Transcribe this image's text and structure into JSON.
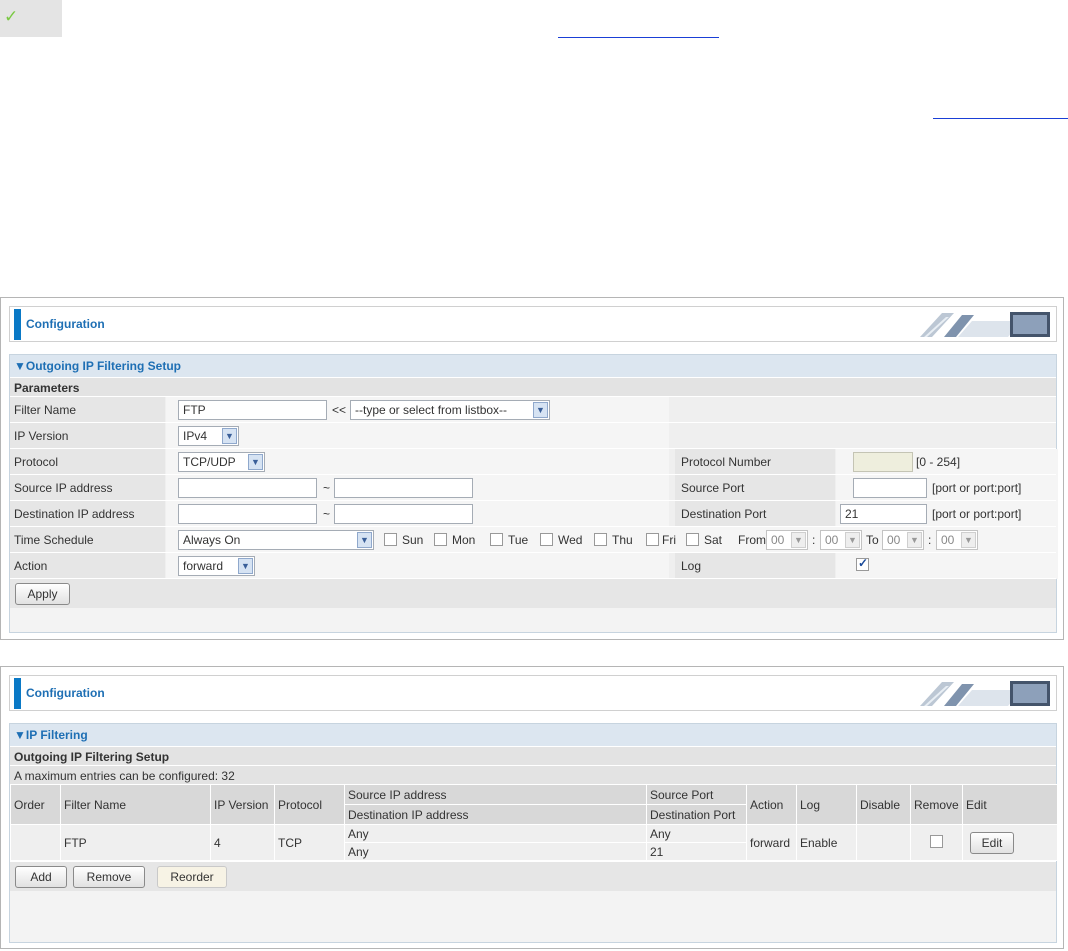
{
  "panel1": {
    "header": "Configuration",
    "section_title": "▼Outgoing IP Filtering Setup",
    "sub_header": "Parameters",
    "filter_name": {
      "label": "Filter Name",
      "value": "FTP",
      "arrows": "<<",
      "listbox": "--type or select from listbox--"
    },
    "ip_version": {
      "label": "IP Version",
      "value": "IPv4"
    },
    "protocol": {
      "label": "Protocol",
      "value": "TCP/UDP"
    },
    "protocol_number": {
      "label": "Protocol Number",
      "value": "",
      "hint": "[0 - 254]"
    },
    "source_ip": {
      "label": "Source IP address",
      "from": "",
      "sep": "~",
      "to": ""
    },
    "source_port": {
      "label": "Source Port",
      "value": "",
      "hint": "[port or port:port]"
    },
    "dest_ip": {
      "label": "Destination IP address",
      "from": "",
      "sep": "~",
      "to": ""
    },
    "dest_port": {
      "label": "Destination Port",
      "value": "21",
      "hint": "[port or port:port]"
    },
    "time_schedule": {
      "label": "Time Schedule",
      "value": "Always On",
      "days": [
        "Sun",
        "Mon",
        "Tue",
        "Wed",
        "Thu",
        "Fri",
        "Sat"
      ],
      "from_label": "From",
      "to_label": "To",
      "colon": ":",
      "from_hour": "00",
      "from_min": "00",
      "to_hour": "00",
      "to_min": "00"
    },
    "action": {
      "label": "Action",
      "value": "forward"
    },
    "log": {
      "label": "Log",
      "checked": true
    },
    "apply_button": "Apply"
  },
  "panel2": {
    "header": "Configuration",
    "section_title": "▼IP Filtering",
    "sub_header": "Outgoing IP Filtering Setup",
    "max_text": "A maximum entries can be configured: 32",
    "columns": {
      "order": "Order",
      "filter_name": "Filter Name",
      "ip_version": "IP Version",
      "protocol": "Protocol",
      "source_ip": "Source IP address",
      "dest_ip": "Destination IP address",
      "source_port": "Source Port",
      "dest_port": "Destination Port",
      "action": "Action",
      "log": "Log",
      "disable": "Disable",
      "remove": "Remove",
      "edit": "Edit"
    },
    "rows": [
      {
        "order": "",
        "filter_name": "FTP",
        "ip_version": "4",
        "protocol": "TCP",
        "source_ip": "Any",
        "dest_ip": "Any",
        "source_port": "Any",
        "dest_port": "21",
        "action": "forward",
        "log": "Enable",
        "disable": "",
        "edit_button": "Edit"
      }
    ],
    "add_button": "Add",
    "remove_button": "Remove",
    "reorder_button": "Reorder"
  },
  "colors": {
    "accent": "#0a79c6",
    "title_text": "#1e6fb4",
    "link_line": "#1a3fd6",
    "check_green": "#7ac943"
  }
}
